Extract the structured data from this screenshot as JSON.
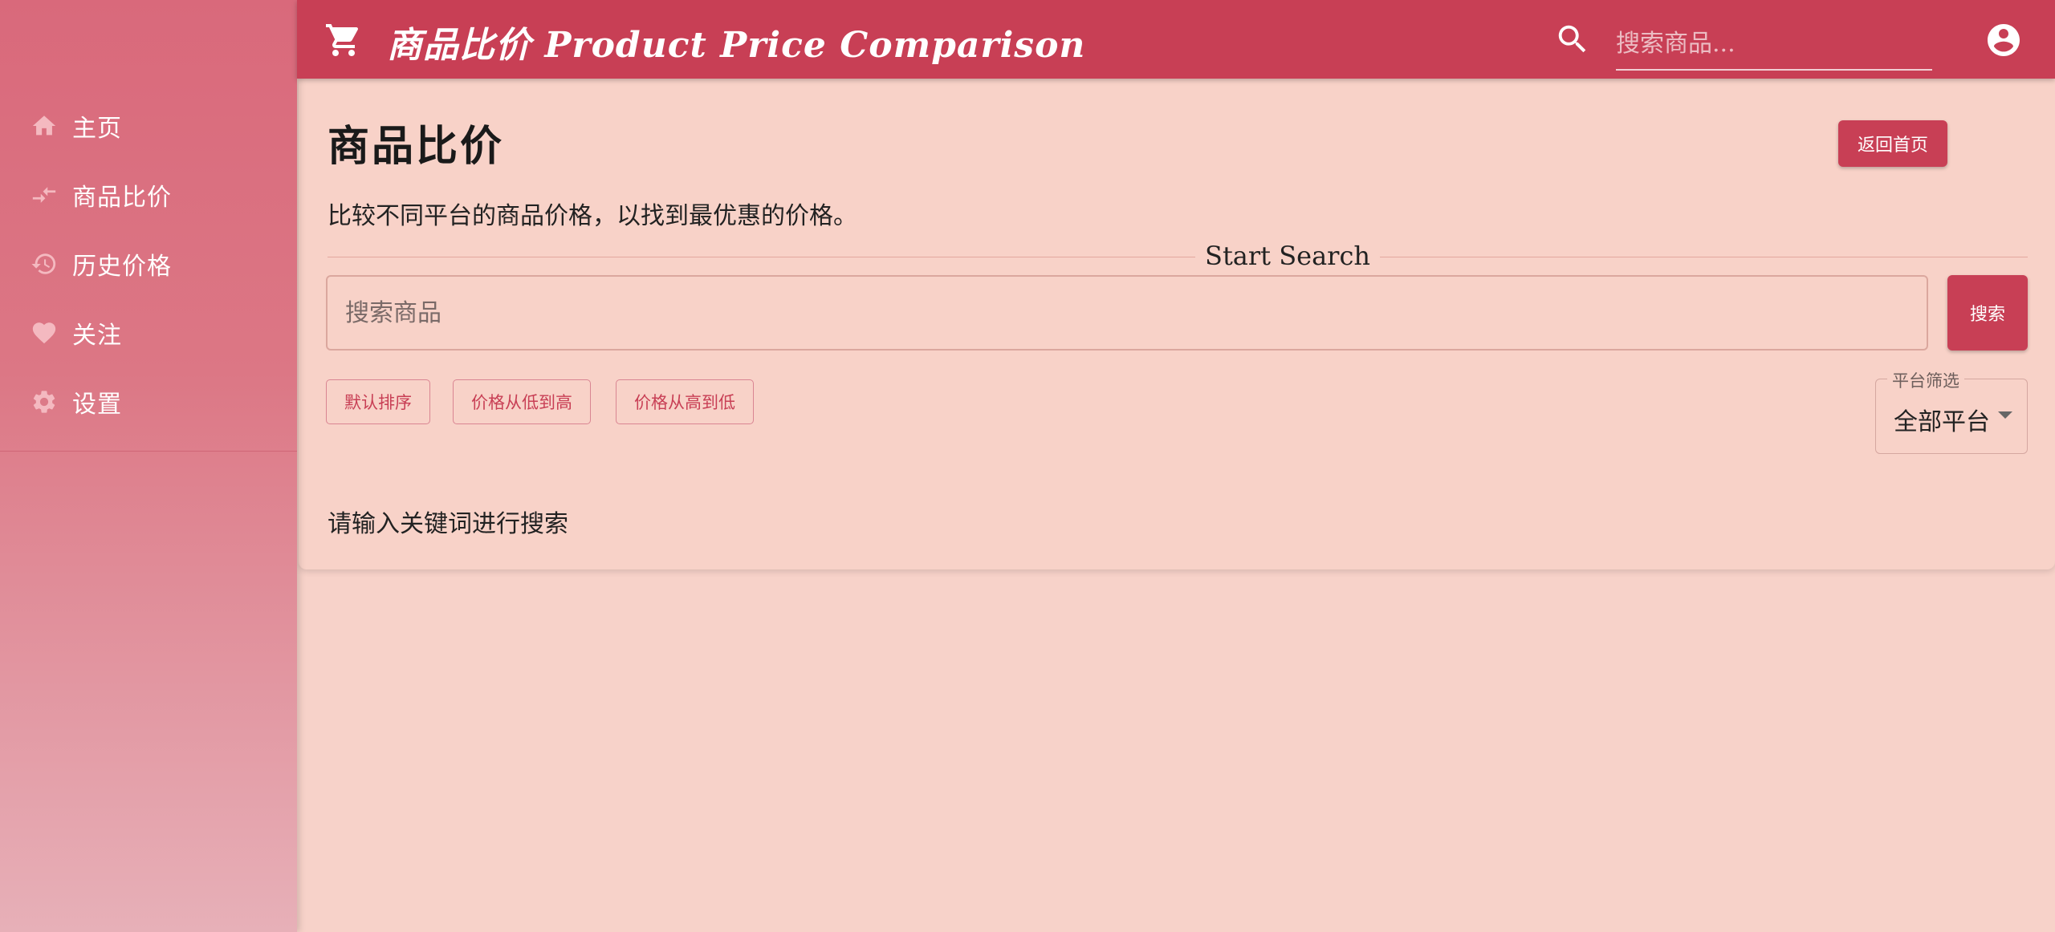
{
  "sidebar": {
    "items": [
      {
        "label": "主页",
        "icon": "home-icon"
      },
      {
        "label": "商品比价",
        "icon": "compare-arrows-icon"
      },
      {
        "label": "历史价格",
        "icon": "history-icon"
      },
      {
        "label": "关注",
        "icon": "heart-icon"
      },
      {
        "label": "设置",
        "icon": "gear-icon"
      }
    ]
  },
  "header": {
    "title": "商品比价 Product Price Comparison",
    "search_placeholder": "搜索商品...",
    "icons": [
      "cart-icon",
      "search-icon",
      "account-circle-icon"
    ]
  },
  "main": {
    "title": "商品比价",
    "back_button": "返回首页",
    "description": "比较不同平台的商品价格，以找到最优惠的价格。",
    "divider_label": "Start Search",
    "search_placeholder": "搜索商品",
    "search_button": "搜索",
    "sort_buttons": [
      "默认排序",
      "价格从低到高",
      "价格从高到低"
    ],
    "platform_filter": {
      "label": "平台筛选",
      "selected": "全部平台"
    },
    "empty_hint": "请输入关键词进行搜索"
  },
  "colors": {
    "primary": "#c83f55",
    "background": "#f8d2c8",
    "sidebar_top": "#d9697b",
    "sidebar_bottom": "#e7b0b8"
  }
}
